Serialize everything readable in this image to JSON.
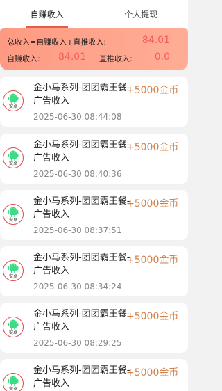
{
  "tabs": [
    {
      "label": "自赚收入",
      "active": true
    },
    {
      "label": "个人提现",
      "active": false
    }
  ],
  "summary": {
    "formula_label": "总收入=自赚收入+直推收入:",
    "total_value": "84.01",
    "self_label": "自赚收入:",
    "self_value": "84.01",
    "direct_label": "直推收入:",
    "direct_value": "0.0"
  },
  "colors": {
    "accent": "#e85a4a",
    "amount": "#d0804b",
    "summary_bg": "#ff9a82",
    "value_red": "#f45b5b",
    "android_green": "#3ddc84"
  },
  "records": [
    {
      "title": "金小马系列-团团霸王餐-广告收入",
      "time": "2025-06-30 08:44:08",
      "amount": "+5000金币",
      "icon": "android-icon",
      "icon_label": "安卓"
    },
    {
      "title": "金小马系列-团团霸王餐-广告收入",
      "time": "2025-06-30 08:40:36",
      "amount": "+5000金币",
      "icon": "android-icon",
      "icon_label": "安卓"
    },
    {
      "title": "金小马系列-团团霸王餐-广告收入",
      "time": "2025-06-30 08:37:51",
      "amount": "+5000金币",
      "icon": "android-icon",
      "icon_label": "安卓"
    },
    {
      "title": "金小马系列-团团霸王餐-广告收入",
      "time": "2025-06-30 08:34:24",
      "amount": "+5000金币",
      "icon": "android-icon",
      "icon_label": "安卓"
    },
    {
      "title": "金小马系列-团团霸王餐-广告收入",
      "time": "2025-06-30 08:29:25",
      "amount": "+5000金币",
      "icon": "android-icon",
      "icon_label": "安卓"
    },
    {
      "title": "金小马系列-团团霸王餐-广告收入",
      "time": "",
      "amount": "+5000金币",
      "icon": "android-icon",
      "icon_label": "安卓"
    }
  ]
}
